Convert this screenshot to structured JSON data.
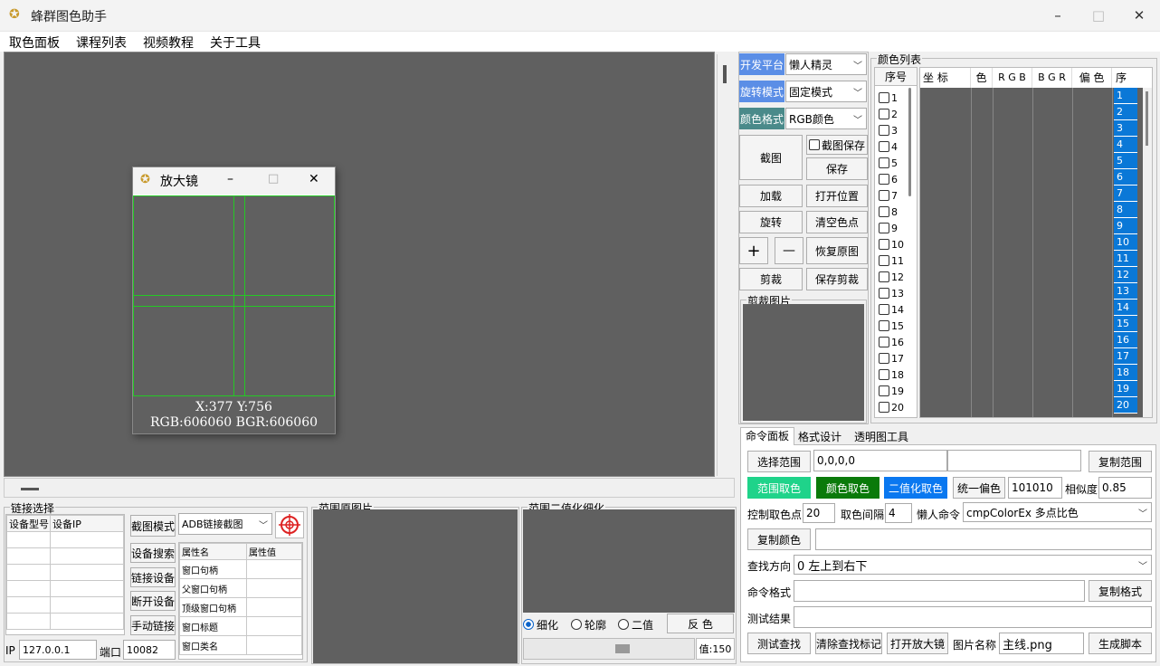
{
  "window": {
    "title": "蜂群图色助手",
    "minimize": "–",
    "maximize": "□",
    "close": "✕"
  },
  "menu": [
    "取色面板",
    "课程列表",
    "视频教程",
    "关于工具"
  ],
  "magnifier": {
    "title": "放大镜",
    "coords": "X:377 Y:756",
    "colors": "RGB:606060 BGR:606060",
    "minimize": "–",
    "maximize": "□",
    "close": "✕"
  },
  "platform": {
    "dev_label": "开发平台",
    "dev_value": "懒人精灵",
    "rotate_label": "旋转模式",
    "rotate_value": "固定模式",
    "format_label": "颜色格式",
    "format_value": "RGB颜色",
    "dev_color": "#5b8ee6",
    "rotate_color": "#5b8ee6",
    "format_color": "#4a8a8a"
  },
  "tools": {
    "screenshot": "截图",
    "save_screenshot": "截图保存",
    "save": "保存",
    "load": "加载",
    "open_location": "打开位置",
    "rotate": "旋转",
    "clear_points": "清空色点",
    "zoom_in": "+",
    "zoom_out": "—",
    "restore": "恢复原图",
    "crop": "剪裁",
    "save_crop": "保存剪裁",
    "crop_image_group": "剪裁图片"
  },
  "color_list": {
    "group": "颜色列表",
    "num_header": "序号",
    "columns": [
      "坐 标",
      "色",
      "R G B",
      "B G R",
      "偏 色",
      "序"
    ],
    "rows": [
      "1",
      "2",
      "3",
      "4",
      "5",
      "6",
      "7",
      "8",
      "9",
      "10",
      "11",
      "12",
      "13",
      "14",
      "15",
      "16",
      "17",
      "18",
      "19",
      "20"
    ]
  },
  "tabs": [
    "命令面板",
    "格式设计",
    "透明图工具"
  ],
  "command": {
    "select_range": "选择范围",
    "range_value": "0,0,0,0",
    "copy_range": "复制范围",
    "range_pick": "范围取色",
    "color_pick": "颜色取色",
    "binary_pick": "二值化取色",
    "uniform_offset": "统一偏色",
    "offset_value": "101010",
    "similarity_label": "相似度",
    "similarity_value": "0.85",
    "control_points_label": "控制取色点",
    "control_points_value": "20",
    "interval_label": "取色间隔",
    "interval_value": "4",
    "lazy_cmd_label": "懒人命令",
    "lazy_cmd_value": "cmpColorEx 多点比色",
    "copy_color": "复制颜色",
    "copy_color_value": "",
    "direction_label": "查找方向",
    "direction_value": "0  左上到右下",
    "cmd_format_label": "命令格式",
    "copy_format": "复制格式",
    "test_result_label": "测试结果",
    "test_find": "测试查找",
    "clear_marks": "清除查找标记",
    "open_magnifier": "打开放大镜",
    "image_name_label": "图片名称",
    "image_name_value": "主线.png",
    "gen_script": "生成脚本",
    "range_pick_color": "#1fd38a",
    "color_pick_color": "#0a7a0a",
    "binary_pick_color": "#0a78f0"
  },
  "link": {
    "group": "链接选择",
    "columns": [
      "设备型号",
      "设备IP"
    ],
    "capture_mode_btn": "截图模式",
    "capture_mode_value": "ADB链接截图",
    "device_search": "设备搜索",
    "link_device": "链接设备",
    "disconnect": "断开设备",
    "manual_link": "手动链接",
    "attr_columns": [
      "属性名",
      "属性值"
    ],
    "attrs": [
      "窗口句柄",
      "父窗口句柄",
      "顶级窗口句柄",
      "窗口标题",
      "窗口类名"
    ],
    "ip_label": "IP",
    "ip_value": "127.0.0.1",
    "port_label": "端口",
    "port_value": "10082"
  },
  "range_original": {
    "group": "范围原图片"
  },
  "binarize": {
    "group": "范围二值化细化",
    "thin": "细化",
    "contour": "轮廓",
    "binary": "二值",
    "invert": "反 色",
    "value_label": "值:150",
    "threshold": 150
  }
}
